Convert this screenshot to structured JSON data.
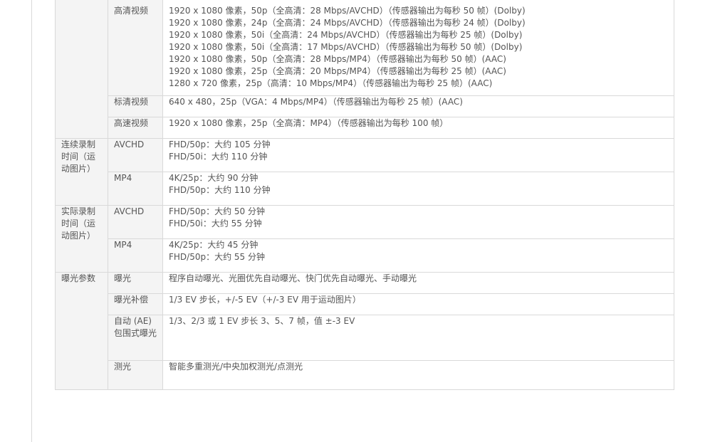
{
  "rows": [
    {
      "category": "",
      "sub": "高清视频",
      "lines": [
        "1920 x 1080 像素，50p（全高清：28 Mbps/AVCHD）（传感器输出为每秒 50 帧）(Dolby)",
        "1920 x 1080 像素，24p（全高清：24 Mbps/AVCHD）（传感器输出为每秒 24 帧）(Dolby)",
        "1920 x 1080 像素，50i（全高清：24 Mbps/AVCHD）（传感器输出为每秒 25 帧）(Dolby)",
        "1920 x 1080 像素，50i（全高清：17 Mbps/AVCHD）（传感器输出为每秒 50 帧）(Dolby)",
        "1920 x 1080 像素，50p（全高清：28 Mbps/MP4）（传感器输出为每秒 50 帧）(AAC)",
        "1920 x 1080 像素，25p（全高清：20 Mbps/MP4）（传感器输出为每秒 25 帧）(AAC)",
        "1280 x 720 像素，25p（高清：10 Mbps/MP4）（传感器输出为每秒 25 帧）(AAC)"
      ]
    },
    {
      "sub": "标清视频",
      "lines": [
        "640 x 480，25p（VGA：4 Mbps/MP4）（传感器输出为每秒 25 帧）(AAC)"
      ]
    },
    {
      "sub": "高速视频",
      "lines": [
        "1920 x 1080 像素，25p（全高清：MP4）（传感器输出为每秒 100 帧）"
      ]
    },
    {
      "category": "连续录制时间（运动图片）",
      "sub": "AVCHD",
      "lines": [
        "FHD/50p：大约 105 分钟",
        "FHD/50i：大约 110 分钟"
      ]
    },
    {
      "sub": "MP4",
      "lines": [
        "4K/25p：大约 90 分钟",
        "FHD/50p：大约 110 分钟"
      ]
    },
    {
      "category": "实际录制时间（运动图片）",
      "sub": "AVCHD",
      "lines": [
        "FHD/50p：大约 50 分钟",
        "FHD/50i：大约 55 分钟"
      ]
    },
    {
      "sub": "MP4",
      "lines": [
        "4K/25p：大约 45 分钟",
        "FHD/50p：大约 55 分钟"
      ]
    },
    {
      "category": "曝光参数",
      "sub": "曝光",
      "lines": [
        "程序自动曝光、光圈优先自动曝光、快门优先自动曝光、手动曝光"
      ]
    },
    {
      "sub": "曝光补偿",
      "lines": [
        "1/3 EV 步长，+/-5 EV（+/-3 EV 用于运动图片）"
      ]
    },
    {
      "sub": "自动 (AE) 包围式曝光",
      "lines": [
        "1/3、2/3 或 1 EV 步长 3、5、7 帧，值 ±-3 EV"
      ]
    },
    {
      "sub": "测光",
      "lines": [
        "智能多重测光/中央加权测光/点测光"
      ]
    }
  ]
}
